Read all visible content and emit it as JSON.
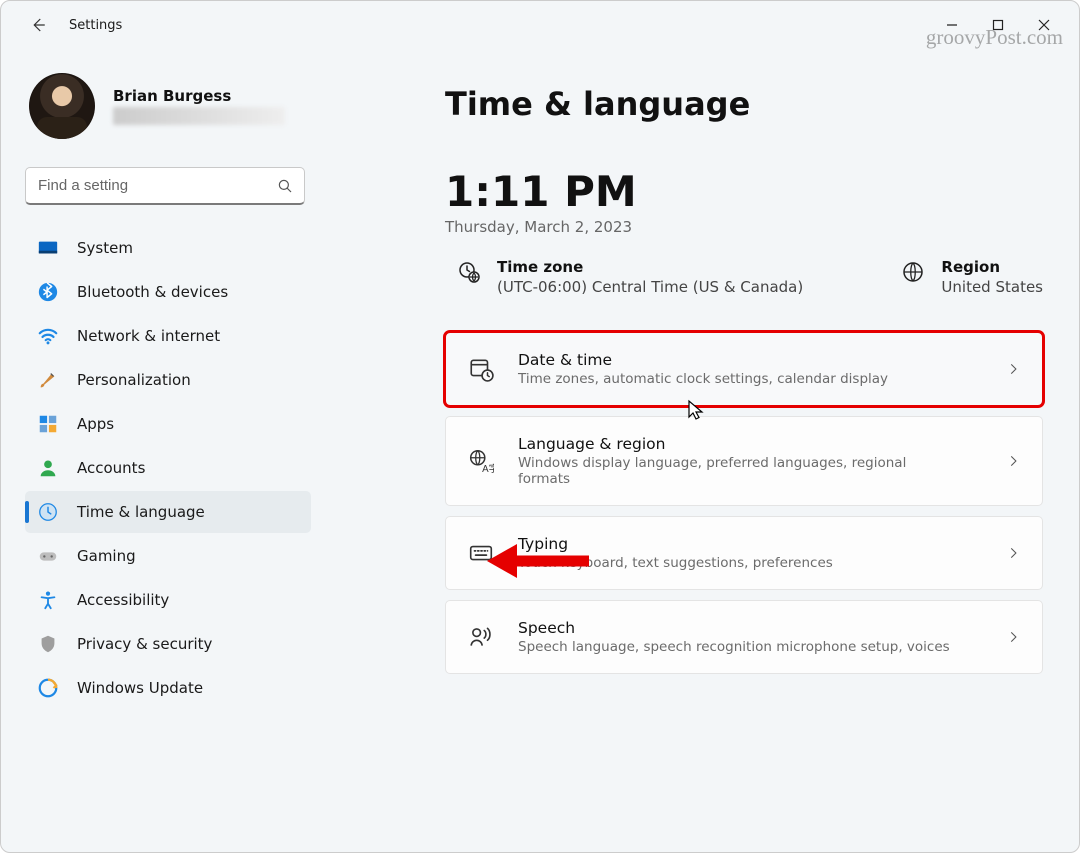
{
  "app": {
    "title": "Settings"
  },
  "watermark": "groovyPost.com",
  "profile": {
    "name": "Brian Burgess"
  },
  "search": {
    "placeholder": "Find a setting"
  },
  "sidebar": {
    "items": [
      {
        "label": "System"
      },
      {
        "label": "Bluetooth & devices"
      },
      {
        "label": "Network & internet"
      },
      {
        "label": "Personalization"
      },
      {
        "label": "Apps"
      },
      {
        "label": "Accounts"
      },
      {
        "label": "Time & language"
      },
      {
        "label": "Gaming"
      },
      {
        "label": "Accessibility"
      },
      {
        "label": "Privacy & security"
      },
      {
        "label": "Windows Update"
      }
    ]
  },
  "main": {
    "heading": "Time & language",
    "time": "1:11 PM",
    "date": "Thursday, March 2, 2023",
    "timezone": {
      "label": "Time zone",
      "value": "(UTC-06:00) Central Time (US & Canada)"
    },
    "region": {
      "label": "Region",
      "value": "United States"
    },
    "cards": [
      {
        "title": "Date & time",
        "sub": "Time zones, automatic clock settings, calendar display"
      },
      {
        "title": "Language & region",
        "sub": "Windows display language, preferred languages, regional formats"
      },
      {
        "title": "Typing",
        "sub": "Touch keyboard, text suggestions, preferences"
      },
      {
        "title": "Speech",
        "sub": "Speech language, speech recognition microphone setup, voices"
      }
    ]
  }
}
